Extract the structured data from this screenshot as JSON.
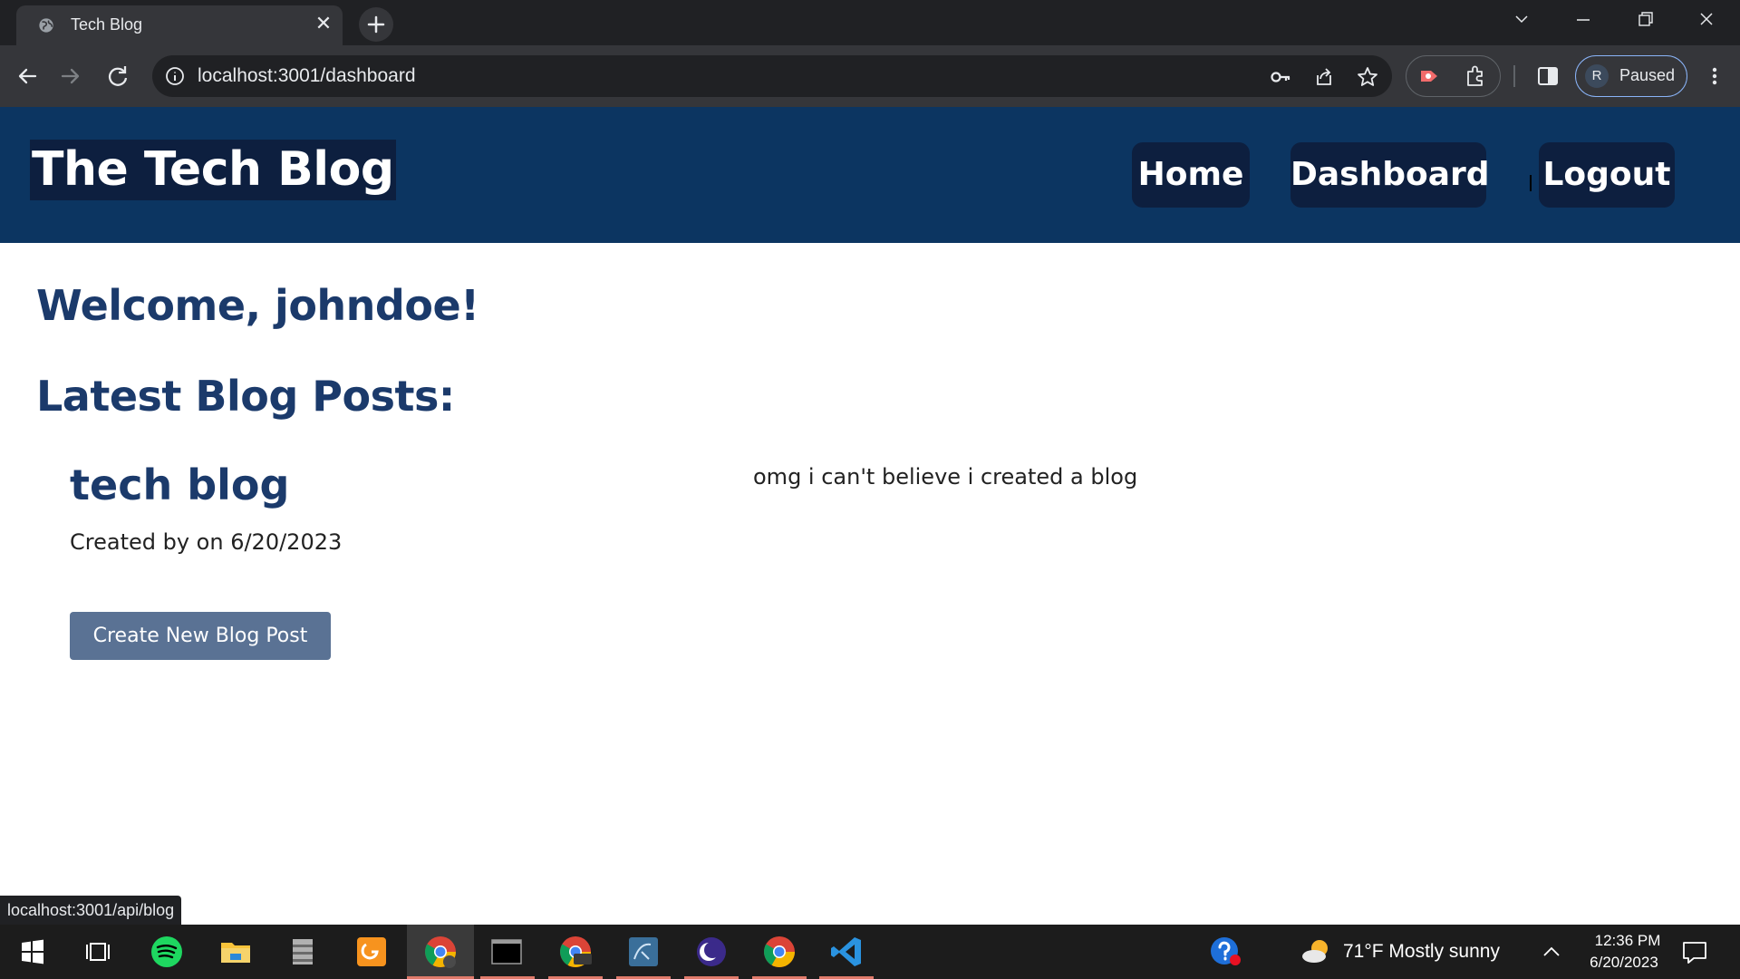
{
  "browser": {
    "tab_title": "Tech Blog",
    "url": "localhost:3001/dashboard",
    "profile_initial": "R",
    "profile_status": "Paused",
    "status_bar_url": "localhost:3001/api/blog"
  },
  "site": {
    "brand": "The Tech Blog",
    "nav": {
      "home": "Home",
      "dashboard": "Dashboard",
      "logout": "Logout"
    }
  },
  "dashboard": {
    "welcome": "Welcome, johndoe!",
    "section_heading": "Latest Blog Posts:",
    "posts": [
      {
        "title": "tech blog",
        "meta": "Created by on 6/20/2023",
        "content": "omg i can't believe i created a blog"
      }
    ],
    "create_button": "Create New Blog Post"
  },
  "taskbar": {
    "weather": "71°F  Mostly sunny",
    "time": "12:36 PM",
    "date": "6/20/2023"
  },
  "colors": {
    "header_bg": "#0c3561",
    "nav_button_bg": "#0d1f3f",
    "heading_text": "#1b3a6b",
    "button_bg": "#5a7294"
  }
}
